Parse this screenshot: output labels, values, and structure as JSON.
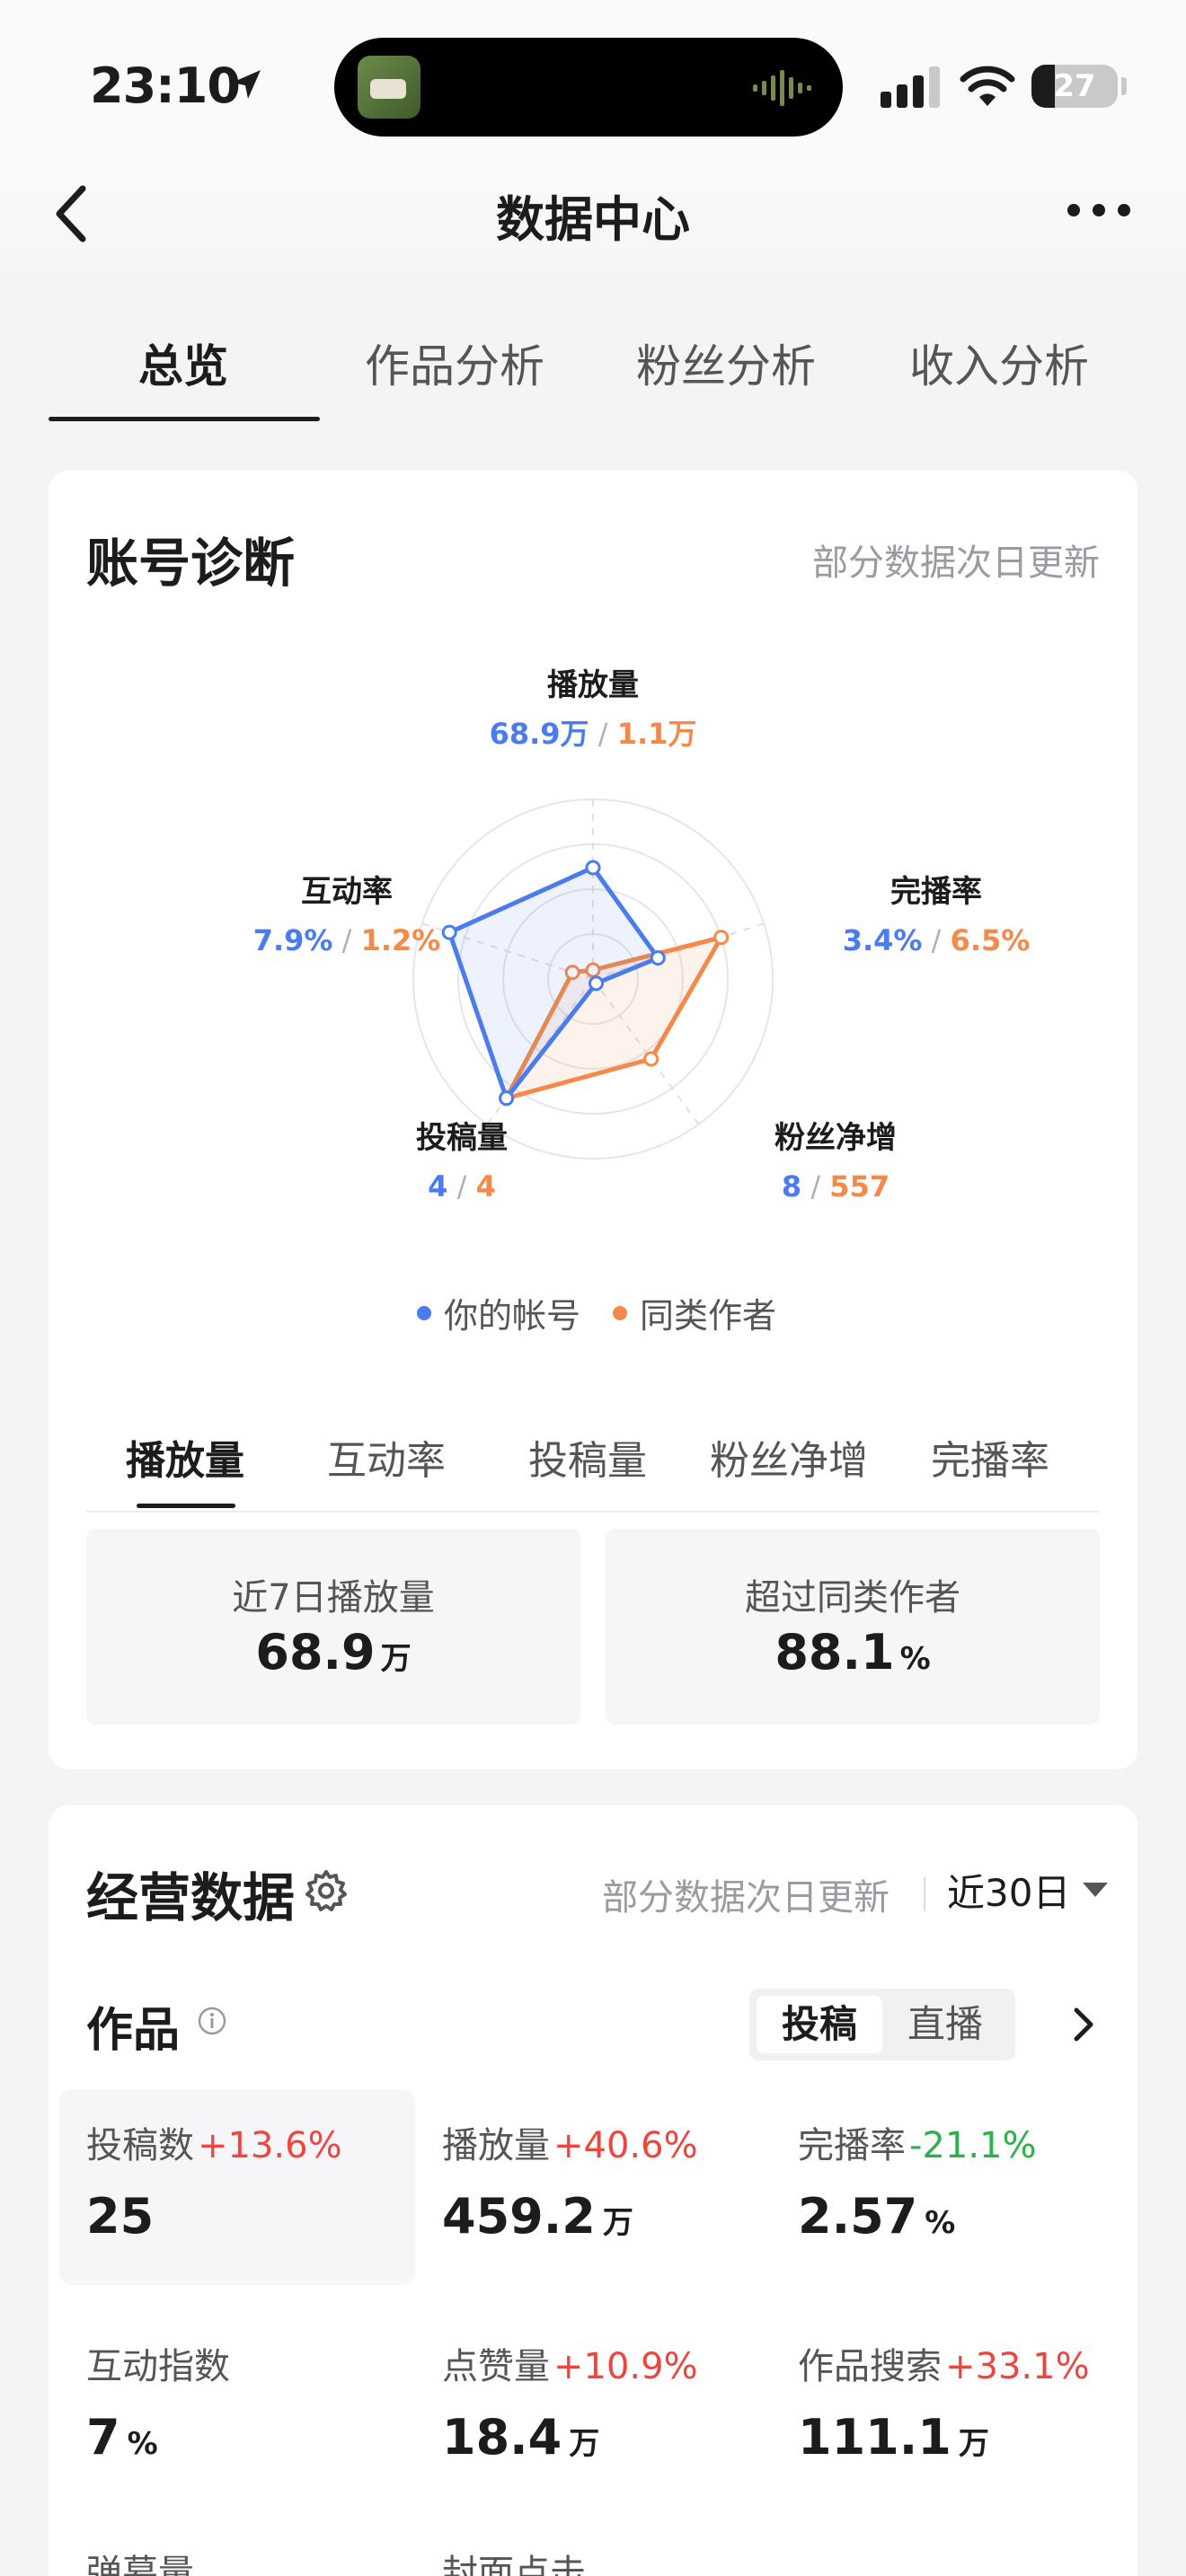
{
  "status": {
    "time": "23:10",
    "battery": "27",
    "battery_level": 0.27
  },
  "nav": {
    "title": "数据中心"
  },
  "tabs": [
    {
      "label": "总览",
      "active": true
    },
    {
      "label": "作品分析"
    },
    {
      "label": "粉丝分析"
    },
    {
      "label": "收入分析"
    }
  ],
  "diagnosis": {
    "title": "账号诊断",
    "note": "部分数据次日更新",
    "radar": {
      "axes": [
        {
          "name": "播放量",
          "mine": "68.9万",
          "peer": "1.1万",
          "mine_level": 0.62,
          "peer_level": 0.05
        },
        {
          "name": "完播率",
          "mine": "3.4%",
          "peer": "6.5%",
          "mine_level": 0.38,
          "peer_level": 0.75
        },
        {
          "name": "粉丝净增",
          "mine": "8",
          "peer": "557",
          "mine_level": 0.03,
          "peer_level": 0.55
        },
        {
          "name": "投稿量",
          "mine": "4",
          "peer": "4",
          "mine_level": 0.82,
          "peer_level": 0.82
        },
        {
          "name": "互动率",
          "mine": "7.9%",
          "peer": "1.2%",
          "mine_level": 0.84,
          "peer_level": 0.12
        }
      ],
      "mine_color": "#4a7cf0",
      "peer_color": "#f58a48"
    },
    "legend": {
      "mine": "你的帐号",
      "peer": "同类作者"
    },
    "metric_tabs": [
      "播放量",
      "互动率",
      "投稿量",
      "粉丝净增",
      "完播率"
    ],
    "stats": [
      {
        "label": "近7日播放量",
        "value": "68.9",
        "unit": "万"
      },
      {
        "label": "超过同类作者",
        "value": "88.1",
        "unit": "%"
      }
    ]
  },
  "business": {
    "title": "经营数据",
    "note": "部分数据次日更新",
    "period": "近30日",
    "section": "作品",
    "segments": [
      "投稿",
      "直播"
    ],
    "metrics": [
      {
        "label": "投稿数",
        "delta": "+13.6%",
        "trend": "up",
        "value": "25",
        "unit": ""
      },
      {
        "label": "播放量",
        "delta": "+40.6%",
        "trend": "up",
        "value": "459.2",
        "unit": "万"
      },
      {
        "label": "完播率",
        "delta": "-21.1%",
        "trend": "down",
        "value": "2.57",
        "unit": "%"
      },
      {
        "label": "互动指数",
        "delta": "",
        "trend": "",
        "value": "7",
        "unit": "%"
      },
      {
        "label": "点赞量",
        "delta": "+10.9%",
        "trend": "up",
        "value": "18.4",
        "unit": "万"
      },
      {
        "label": "作品搜索",
        "delta": "+33.1%",
        "trend": "up",
        "value": "111.1",
        "unit": "万"
      }
    ],
    "partial": [
      "弹幕量",
      "封面点击"
    ]
  }
}
